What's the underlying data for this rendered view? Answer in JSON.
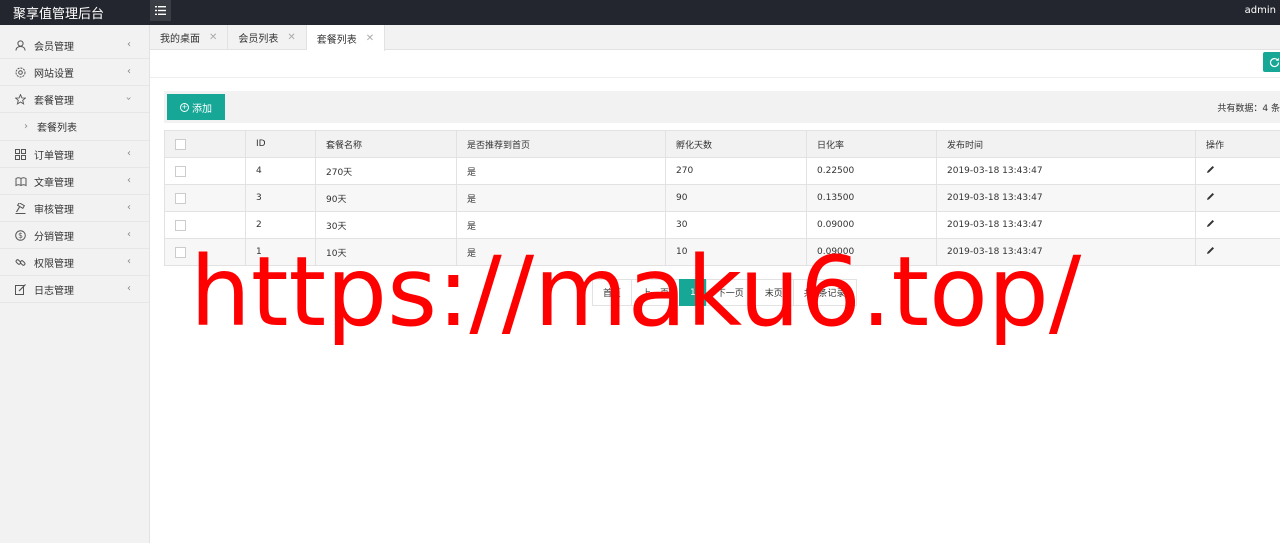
{
  "app": {
    "title": "聚享值管理后台",
    "user": "admin"
  },
  "sidebar": {
    "items": [
      {
        "label": "会员管理",
        "icon": "user-icon"
      },
      {
        "label": "网站设置",
        "icon": "gear-icon"
      },
      {
        "label": "套餐管理",
        "icon": "star-icon",
        "expanded": true,
        "children": [
          {
            "label": "套餐列表"
          }
        ]
      },
      {
        "label": "订单管理",
        "icon": "grid-icon"
      },
      {
        "label": "文章管理",
        "icon": "book-icon"
      },
      {
        "label": "审核管理",
        "icon": "hammer-icon"
      },
      {
        "label": "分销管理",
        "icon": "dollar-icon"
      },
      {
        "label": "权限管理",
        "icon": "link-icon"
      },
      {
        "label": "日志管理",
        "icon": "edit-icon"
      }
    ]
  },
  "tabs": [
    {
      "label": "我的桌面",
      "active": false
    },
    {
      "label": "会员列表",
      "active": false
    },
    {
      "label": "套餐列表",
      "active": true
    }
  ],
  "toolbar": {
    "add_label": "添加",
    "total_label": "共有数据：",
    "total_value": "4 条"
  },
  "table": {
    "columns": [
      "",
      "ID",
      "套餐名称",
      "是否推荐到首页",
      "孵化天数",
      "日化率",
      "发布时间",
      "操作"
    ],
    "rows": [
      {
        "id": "4",
        "name": "270天",
        "recommend": "是",
        "days": "270",
        "rate": "0.22500",
        "time": "2019-03-18 13:43:47"
      },
      {
        "id": "3",
        "name": "90天",
        "recommend": "是",
        "days": "90",
        "rate": "0.13500",
        "time": "2019-03-18 13:43:47"
      },
      {
        "id": "2",
        "name": "30天",
        "recommend": "是",
        "days": "30",
        "rate": "0.09000",
        "time": "2019-03-18 13:43:47"
      },
      {
        "id": "1",
        "name": "10天",
        "recommend": "是",
        "days": "10",
        "rate": "0.09000",
        "time": "2019-03-18 13:43:47"
      }
    ]
  },
  "pager": {
    "first": "首页",
    "prev": "上一页",
    "current": "1",
    "next": "下一页",
    "last": "末页",
    "info": "共4条记录"
  },
  "watermark": "https://maku6.top/",
  "colors": {
    "accent": "#16a796",
    "topbar": "#23262e",
    "watermark": "#ff0000"
  }
}
